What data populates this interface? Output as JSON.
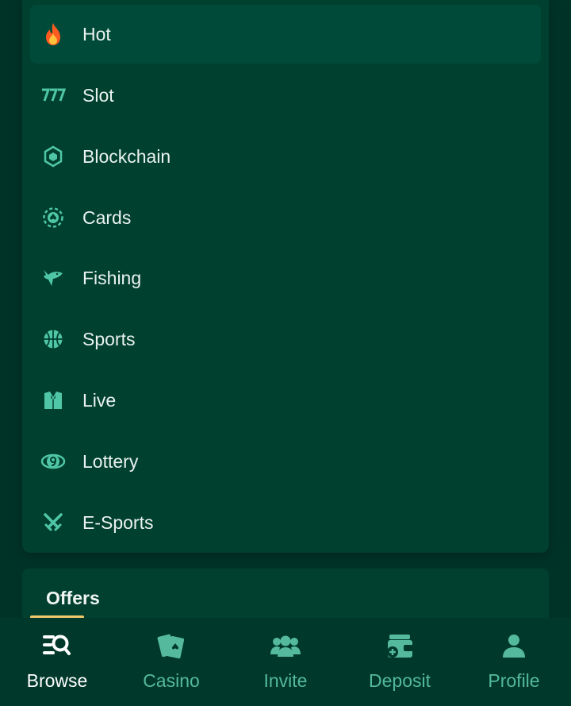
{
  "menu": {
    "items": [
      {
        "label": "Hot",
        "icon": "fire-icon"
      },
      {
        "label": "Slot",
        "icon": "slot-777-icon"
      },
      {
        "label": "Blockchain",
        "icon": "cube-icon"
      },
      {
        "label": "Cards",
        "icon": "poker-chip-icon"
      },
      {
        "label": "Fishing",
        "icon": "shark-icon"
      },
      {
        "label": "Sports",
        "icon": "basketball-icon"
      },
      {
        "label": "Live",
        "icon": "tuxedo-icon"
      },
      {
        "label": "Lottery",
        "icon": "lottery-ball-icon"
      },
      {
        "label": "E-Sports",
        "icon": "crossed-swords-icon"
      }
    ],
    "active_index": 0
  },
  "offers": {
    "label": "Offers"
  },
  "bottom_nav": {
    "items": [
      {
        "label": "Browse",
        "icon": "browse-search-icon"
      },
      {
        "label": "Casino",
        "icon": "cards-icon"
      },
      {
        "label": "Invite",
        "icon": "users-icon"
      },
      {
        "label": "Deposit",
        "icon": "wallet-plus-icon"
      },
      {
        "label": "Profile",
        "icon": "user-icon"
      }
    ],
    "active_index": 0
  },
  "colors": {
    "background": "#003328",
    "panel": "#00402f",
    "accent": "#54b99d",
    "highlight": "#f1c96a",
    "fire": "#ff5a1f"
  }
}
